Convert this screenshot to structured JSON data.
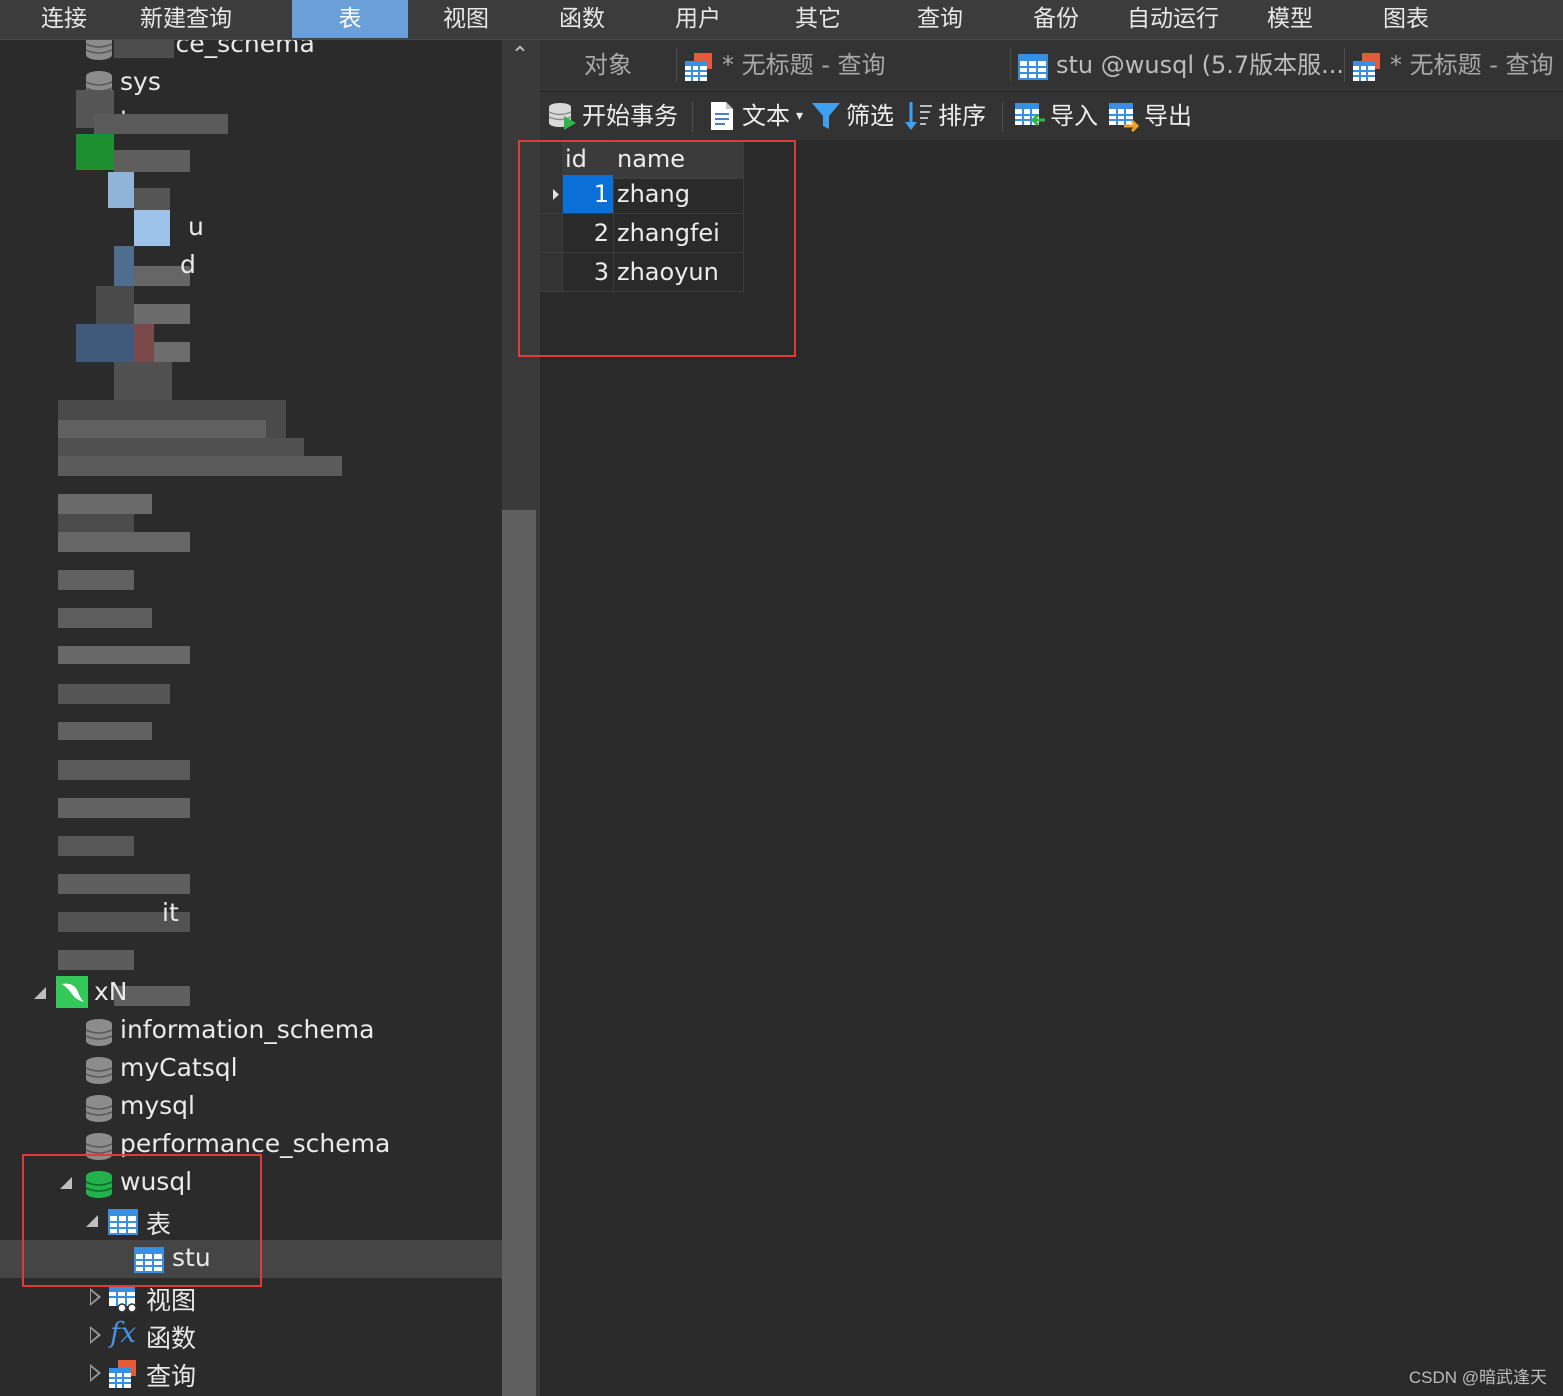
{
  "menu": {
    "items": [
      "连接",
      "新建查询",
      "表",
      "视图",
      "函数",
      "用户",
      "其它",
      "查询",
      "备份",
      "自动运行",
      "模型",
      "图表"
    ],
    "active": "表"
  },
  "navigator": {
    "top_partial": [
      "mance_schema",
      "sys",
      "tes"
    ],
    "fragments": [
      "u",
      "d",
      "it"
    ],
    "connection_fragment": "xN",
    "databases": [
      "information_schema",
      "myCatsql",
      "mysql",
      "performance_schema"
    ],
    "open_database": "wusql",
    "tables_node": "表",
    "selected_table": "stu",
    "other_nodes": [
      "视图",
      "函数",
      "查询"
    ]
  },
  "tabs": {
    "objects": "对象",
    "query1": "* 无标题 - 查询",
    "table_tab": "stu @wusql (5.7版本服...",
    "query2": "* 无标题 - 查询"
  },
  "toolbar": {
    "begin_transaction": "开始事务",
    "text": "文本",
    "filter": "筛选",
    "sort": "排序",
    "import": "导入",
    "export": "导出"
  },
  "grid": {
    "columns": [
      "id",
      "name"
    ],
    "rows": [
      {
        "id": "1",
        "name": "zhang"
      },
      {
        "id": "2",
        "name": "zhangfei"
      },
      {
        "id": "3",
        "name": "zhaoyun"
      }
    ],
    "selected_row": 0
  },
  "watermark": "CSDN @暗武逢天",
  "colors": {
    "highlight_box": "#e03a3a",
    "active_menu": "#6a9fd8",
    "selected_cell": "#0a6fd6",
    "db_open_green": "#22b14c",
    "table_icon_blue": "#3b8fe0"
  }
}
